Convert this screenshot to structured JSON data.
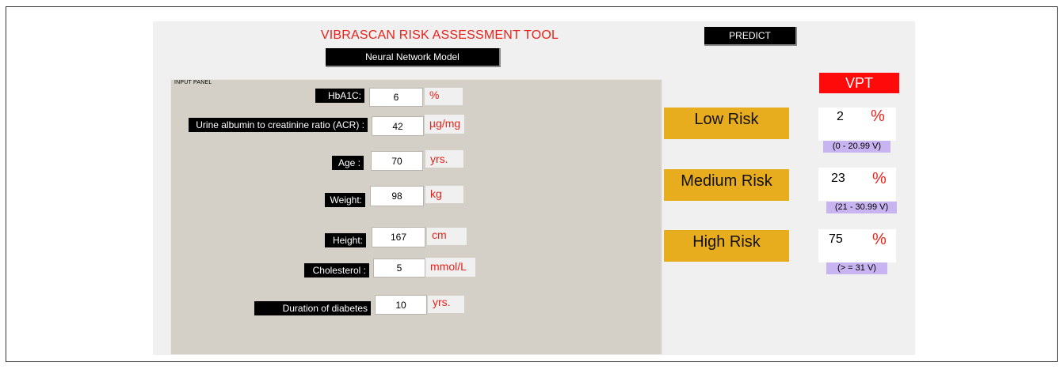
{
  "app": {
    "title": "VIBRASCAN RISK ASSESSMENT TOOL",
    "model_label": "Neural Network Model",
    "predict_label": "PREDICT"
  },
  "input_panel": {
    "title": "INPUT PANEL",
    "fields": [
      {
        "label": "HbA1C:",
        "value": "6",
        "unit": "%"
      },
      {
        "label": "Urine albumin to creatinine ratio (ACR) :",
        "value": "42",
        "unit": "µg/mg"
      },
      {
        "label": "Age :",
        "value": "70",
        "unit": "yrs."
      },
      {
        "label": "Weight:",
        "value": "98",
        "unit": "kg"
      },
      {
        "label": "Height:",
        "value": "167",
        "unit": "cm"
      },
      {
        "label": "Cholesterol :",
        "value": "5",
        "unit": "mmol/L"
      },
      {
        "label": "Duration of diabetes",
        "value": "10",
        "unit": "yrs."
      }
    ]
  },
  "output": {
    "header": "VPT",
    "risks": [
      {
        "label": "Low Risk",
        "value": "2",
        "unit": "%",
        "range": "(0 - 20.99 V)"
      },
      {
        "label": "Medium Risk",
        "value": "23",
        "unit": "%",
        "range": "(21 - 30.99 V)"
      },
      {
        "label": "High Risk",
        "value": "75",
        "unit": "%",
        "range": "(> = 31 V)"
      }
    ]
  },
  "colors": {
    "title_red": "#e8221a",
    "risk_orange": "#e8ad1e",
    "vpt_red": "#ff0a0a",
    "range_purple": "#c7b4f0"
  }
}
